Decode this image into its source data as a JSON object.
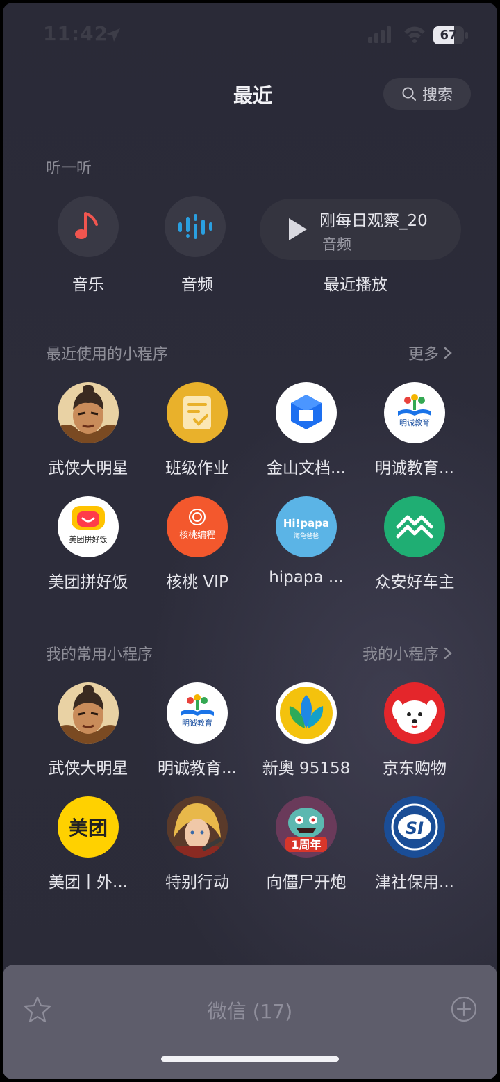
{
  "status_bar": {
    "time": "11:42",
    "battery": "67"
  },
  "header": {
    "title": "最近",
    "search_label": "搜索"
  },
  "listen": {
    "section_label": "听一听",
    "items": [
      {
        "label": "音乐",
        "icon": "music-note-icon",
        "color": "#f0554f"
      },
      {
        "label": "音频",
        "icon": "audio-wave-icon",
        "color": "#2a9fe0"
      }
    ],
    "recent": {
      "caption": "最近播放",
      "title": "刚每日观察_20",
      "subtitle": "音频"
    }
  },
  "recent_apps": {
    "section_label": "最近使用的小程序",
    "more_label": "更多",
    "items": [
      {
        "name": "武侠大明星",
        "icon": "warrior-avatar"
      },
      {
        "name": "班级作业",
        "icon": "homework-icon"
      },
      {
        "name": "金山文档...",
        "icon": "kdocs-icon"
      },
      {
        "name": "明诚教育...",
        "icon": "mingcheng-education-icon",
        "logo_text": "明诚教育"
      },
      {
        "name": "美团拼好饭",
        "icon": "meituan-pinhaofan-icon",
        "logo_text": "美团拼好饭"
      },
      {
        "name": "核桃 VIP",
        "icon": "hetao-coding-icon",
        "logo_text": "核桃编程"
      },
      {
        "name": "hipapa ...",
        "icon": "hipapa-icon",
        "logo_text": "Hi!papa",
        "logo_sub": "海龟爸爸"
      },
      {
        "name": "众安好车主",
        "icon": "zhongan-car-icon"
      }
    ]
  },
  "my_apps": {
    "section_label": "我的常用小程序",
    "more_label": "我的小程序",
    "items": [
      {
        "name": "武侠大明星",
        "icon": "warrior-avatar"
      },
      {
        "name": "明诚教育...",
        "icon": "mingcheng-education-icon",
        "logo_text": "明诚教育"
      },
      {
        "name": "新奥 95158",
        "icon": "enn-icon"
      },
      {
        "name": "京东购物",
        "icon": "jd-dog-icon"
      },
      {
        "name": "美团丨外...",
        "icon": "meituan-icon",
        "logo_text": "美团"
      },
      {
        "name": "特别行动",
        "icon": "special-ops-avatar"
      },
      {
        "name": "向僵尸开炮",
        "icon": "zombie-game-icon",
        "logo_text": "1周年"
      },
      {
        "name": "津社保用...",
        "icon": "social-security-icon",
        "logo_text": "SI"
      }
    ]
  },
  "bottom_bar": {
    "label": "微信 (17)"
  }
}
